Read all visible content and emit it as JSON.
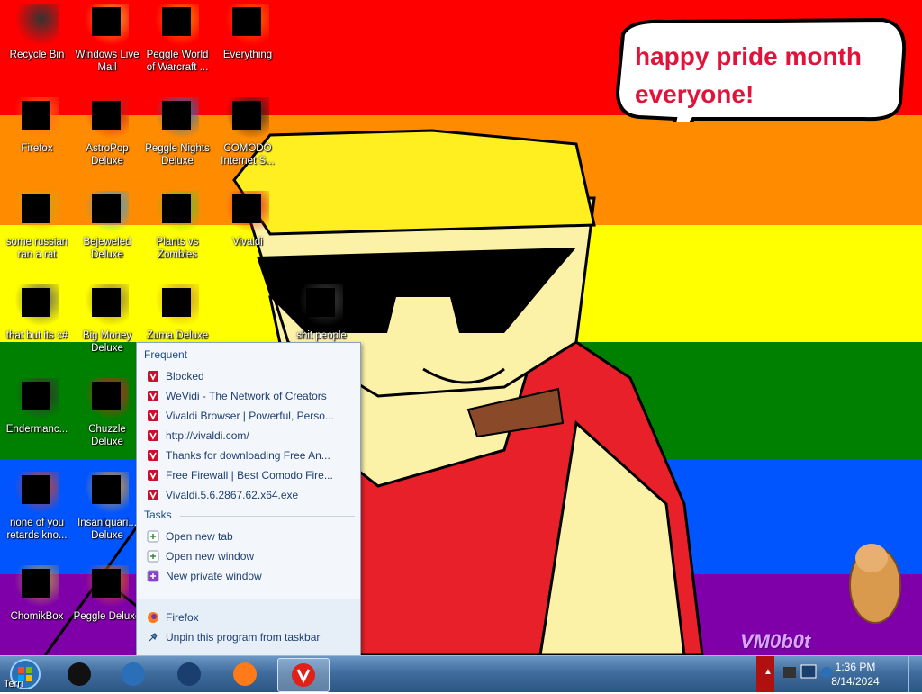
{
  "desktop": {
    "icons": [
      {
        "label": "Recycle Bin"
      },
      {
        "label": "Windows Live Mail"
      },
      {
        "label": "Peggle World of Warcraft ..."
      },
      {
        "label": "Everything"
      },
      {
        "label": "Firefox"
      },
      {
        "label": "AstroPop Deluxe"
      },
      {
        "label": "Peggle Nights Deluxe"
      },
      {
        "label": "COMODO Internet S..."
      },
      {
        "label": "some russian ran a rat"
      },
      {
        "label": "Bejeweled Deluxe"
      },
      {
        "label": "Plants vs Zombies"
      },
      {
        "label": "Vivaldi"
      },
      {
        "label": "that but its c#"
      },
      {
        "label": "Big Money Deluxe"
      },
      {
        "label": "Zuma Deluxe"
      },
      {
        "label": "shit people"
      },
      {
        "label": "Endermanc..."
      },
      {
        "label": "Chuzzle Deluxe"
      },
      {
        "label": "none of you retards kno..."
      },
      {
        "label": "Insaniquari... Deluxe"
      },
      {
        "label": "ChomikBox"
      },
      {
        "label": "Peggle Deluxe"
      }
    ],
    "bubble_text": "happy pride month everyone!",
    "watermark": "VM0b0t"
  },
  "jumplist": {
    "frequent_header": "Frequent",
    "frequent": [
      {
        "label": "Blocked"
      },
      {
        "label": "WeVidi - The Network of Creators"
      },
      {
        "label": "Vivaldi Browser | Powerful, Perso..."
      },
      {
        "label": "http://vivaldi.com/"
      },
      {
        "label": "Thanks for downloading Free An..."
      },
      {
        "label": "Free Firewall | Best Comodo Fire..."
      },
      {
        "label": "Vivaldi.5.6.2867.62.x64.exe"
      }
    ],
    "tasks_header": "Tasks",
    "tasks": [
      {
        "label": "Open new tab"
      },
      {
        "label": "Open new window"
      },
      {
        "label": "New private window"
      }
    ],
    "program": "Firefox",
    "unpin": "Unpin this program from taskbar"
  },
  "taskbar": {
    "start_label": "Start",
    "running_label": "Terri",
    "pinned": [
      {
        "name": "blackbox"
      },
      {
        "name": "media-player"
      },
      {
        "name": "globe"
      },
      {
        "name": "firefox"
      },
      {
        "name": "vivaldi"
      }
    ]
  },
  "clock": {
    "time": "1:36 PM",
    "date": "8/14/2024"
  },
  "colors": {
    "red": "#ff0000",
    "orange": "#ff8c00",
    "yellow": "#ffff00",
    "green": "#008000",
    "blue": "#0055ff",
    "purple": "#7f00a8",
    "bubble_text": "#e0133a"
  }
}
